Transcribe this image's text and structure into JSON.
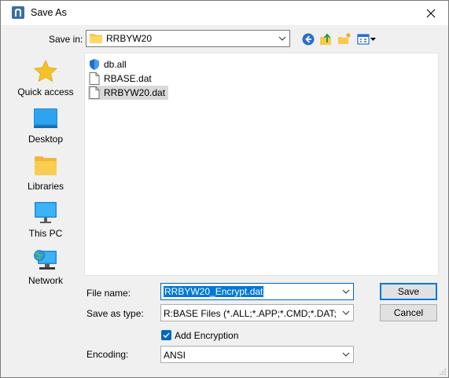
{
  "window": {
    "title": "Save As"
  },
  "toolbar": {
    "save_in_label": "Save in:",
    "save_in_value": "RRBYW20"
  },
  "places": [
    {
      "label": "Quick access",
      "icon": "star-icon"
    },
    {
      "label": "Desktop",
      "icon": "desktop-icon"
    },
    {
      "label": "Libraries",
      "icon": "libraries-icon"
    },
    {
      "label": "This PC",
      "icon": "computer-icon"
    },
    {
      "label": "Network",
      "icon": "network-icon"
    }
  ],
  "files": [
    {
      "name": "db.all",
      "icon": "shield-file-icon",
      "selected": false
    },
    {
      "name": "RBASE.dat",
      "icon": "document-icon",
      "selected": false
    },
    {
      "name": "RRBYW20.dat",
      "icon": "document-icon",
      "selected": true
    }
  ],
  "form": {
    "file_name_label": "File name:",
    "file_name_value": "RRBYW20_Encrypt.dat",
    "save_as_type_label": "Save as type:",
    "save_as_type_value": "R:BASE Files (*.ALL;*.APP;*.CMD;*.DAT;*.EEP",
    "add_encryption_label": "Add Encryption",
    "add_encryption_checked": true,
    "encoding_label": "Encoding:",
    "encoding_value": "ANSI"
  },
  "buttons": {
    "save": "Save",
    "cancel": "Cancel"
  },
  "colors": {
    "accent": "#0078d7",
    "selection": "#d9d9d9",
    "folder": "#f8c94a"
  }
}
